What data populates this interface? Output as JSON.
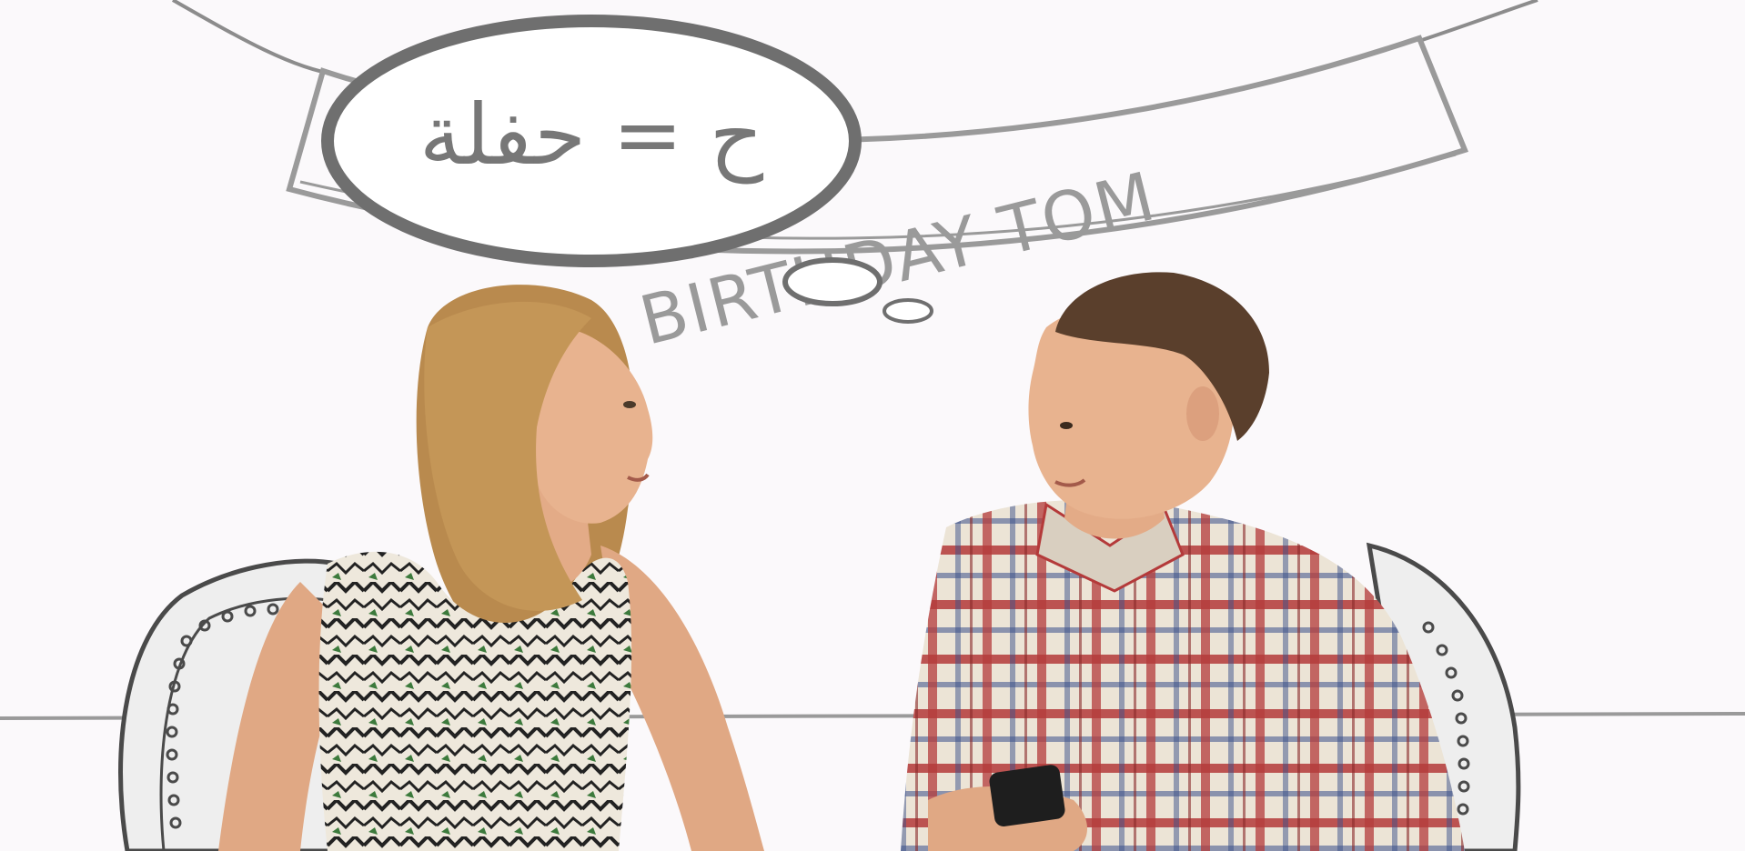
{
  "banner": {
    "text": "BIRTHDAY TOM"
  },
  "thought_bubble": {
    "text": "ح = حفلة"
  },
  "colors": {
    "background": "#fbf9fb",
    "line": "#8c8c8c",
    "bubble_outline": "#6f6f6f",
    "banner_text": "#9a9a9a",
    "bubble_text": "#777777",
    "skin": "#e6b08e",
    "hair_woman": "#b98a4e",
    "hair_man": "#5a3f2c",
    "shirt_red": "#b43a3a",
    "shirt_cream": "#ece4d6"
  }
}
